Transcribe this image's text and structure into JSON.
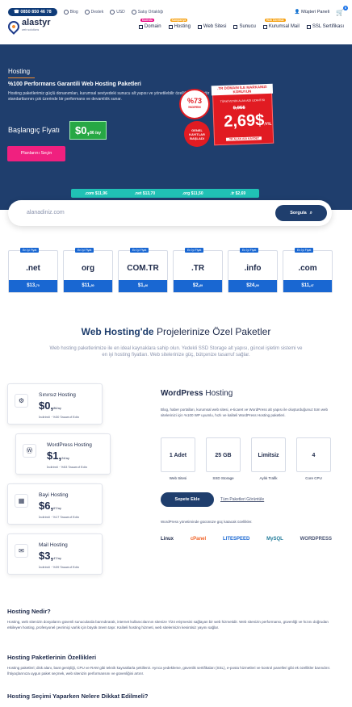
{
  "topbar": {
    "phone": "0850 850 46 78",
    "blog": "Blog",
    "support": "Destek",
    "usd": "USD",
    "partner": "Satış Ortaklığı",
    "customer": "Müşteri Paneli",
    "cart_count": "0"
  },
  "logo": {
    "name": "alastyr",
    "sub": "web solutions"
  },
  "nav": [
    {
      "label": "Domain",
      "tag": "Kadrolu",
      "tag_color": "#e6007e"
    },
    {
      "label": "Hosting",
      "tag": "Kampanya",
      "tag_color": "#f59e0b"
    },
    {
      "label": "Web Sitesi",
      "tag": "",
      "tag_color": ""
    },
    {
      "label": "Sunucu",
      "tag": "",
      "tag_color": ""
    },
    {
      "label": "Kurumsal Mail",
      "tag": "Hızlı Ücretsiz",
      "tag_color": "#f59e0b"
    },
    {
      "label": "SSL Sertifikası",
      "tag": "",
      "tag_color": ""
    }
  ],
  "hero": {
    "label": "Hosting",
    "title": "%100 Performans Garantili Web Hosting Paketleri",
    "desc": "Hosting paketlerimiz güçlü donanımları, kurumsal seviyedeki sunucu alt yapısı ve yönetilebilir özellikleri ile sektör standartlarının çok üzerinde bir performans ve devamlılık sunar.",
    "start": "Başlangıç Fiyatı",
    "price": "$0,",
    "price_small": "86 /ay",
    "button": "Planlarını Seçin"
  },
  "promo": {
    "percent": "%73",
    "percent_label": "İNDİRİM",
    "red_badge": "GENEL KAYITLAR BAŞLADI",
    "header": ".TR DOMAIN İLE MARKANIZI KORUYUN",
    "sub": "TÜRKİYE'NİN ALAN ADI UZANTISI",
    "old": "9,95$",
    "new": "2,69$",
    "new_small": "/YIL",
    "footer": ".TR ALAN ADI KAYDET"
  },
  "tlds": [
    ".com $11,96",
    ".net $13,70",
    ".org $11,50",
    ".tr $2,69"
  ],
  "search": {
    "placeholder": "alanadiniz.com",
    "button": "Sorgula"
  },
  "domains": [
    {
      "tag": "En İyi Fiyat",
      "name": ".net",
      "price": "$13,",
      "cents": "70"
    },
    {
      "tag": "En İyi Fiyat",
      "name": "org",
      "price": "$11,",
      "cents": "50"
    },
    {
      "tag": "En İyi Fiyat",
      "name": "COM.TR",
      "price": "$1,",
      "cents": "46"
    },
    {
      "tag": "En İyi Fiyat",
      "name": ".TR",
      "price": "$2,",
      "cents": "69"
    },
    {
      "tag": "En İyi Fiyat",
      "name": ".info",
      "price": "$24,",
      "cents": "99"
    },
    {
      "tag": "En İyi Fiyat",
      "name": ".com",
      "price": "$11,",
      "cents": "47"
    }
  ],
  "section": {
    "title_bold": "Web Hosting'de",
    "title_rest": " Projelerinize Özel Paketler",
    "lead": "Web hosting paketlerimize ile en ideal kaynaklara sahip olun. Yedekli SSD Storage alt yapısı, güncel işletim sistemi ve en iyi hosting fiyatları. Web sitelerinize güç, bütçenize tasarruf sağlar."
  },
  "packages": [
    {
      "name": "Sınırsız Hosting",
      "price": "$0,",
      "cents": "86",
      "unit": "/ay",
      "save": "İndirimli · %30 Tasarruf Edin"
    },
    {
      "name": "WordPress Hosting",
      "price": "$1,",
      "cents": "24",
      "unit": "/ay",
      "save": "İndirimli · %53 Tasarruf Edin"
    },
    {
      "name": "Bayi Hosting",
      "price": "$6,",
      "cents": "67",
      "unit": "/ay",
      "save": "İndirimli · %17 Tasarruf Edin"
    },
    {
      "name": "Mail Hosting",
      "price": "$3,",
      "cents": "47",
      "unit": "/ay",
      "save": "İndirimli · %39 Tasarruf Edin"
    }
  ],
  "wp": {
    "title_bold": "WordPress",
    "title_rest": " Hosting",
    "desc": "Blog, haber portalları, kurumsal web sitesi, e-ticaret ve WordPress alt yapısı ile oluşturduğunuz tüm web sitelerinizi için %100 WP uyumlu, hızlı ve kaliteli WordPress Hosting paketleri.",
    "features": [
      {
        "value": "1 Adet",
        "label": "Web Sitesi"
      },
      {
        "value": "25 GB",
        "label": "SSD Storage"
      },
      {
        "value": "Limitsiz",
        "label": "Aylık Trafik"
      },
      {
        "value": "4",
        "label": "Core CPU"
      }
    ],
    "cart": "Sepete Ekle",
    "all": "Tüm Paketleri Görüntüle",
    "note": "WordPress yönetiminde gücünüze güç katacak özellikler.",
    "logos": [
      "Linux",
      "cPanel",
      "LITESPEED",
      "MySQL",
      "WORDPRESS"
    ]
  },
  "faq": [
    {
      "q": "Hosting Nedir?",
      "a": "Hosting, web sitenizin dosyalarını güvenli sunucularda barındırarak, internet kullanıcılarının sitenize 7/24 erişmesini sağlayan bir web hizmetidir. Web sitenizin performansı, güvenliği ve hızını doğrudan etkileyen hosting, profesyonel çevrimiçi varlık için büyük önem taşır. Kaliteli hosting hizmeti, web sitelerinizin kesintisiz yayını sağlar."
    },
    {
      "q": "Hosting Paketlerinin Özellikleri",
      "a": "Hosting paketleri; disk alanı, bant genişliği, CPU ve RAM gibi teknik kaynaklarla şekillenir. Ayrıca yedekleme, güvenlik sertifikaları (SSL), e-posta hizmetleri ve kontrol panelleri gibi ek özellikler barındırır. İhtiyaçlarınıza uygun paket seçmek, web sitenizin performansını ve güvenliğini artırır."
    },
    {
      "q": "Hosting Seçimi Yaparken Nelere Dikkat Edilmeli?",
      "a": ""
    }
  ]
}
